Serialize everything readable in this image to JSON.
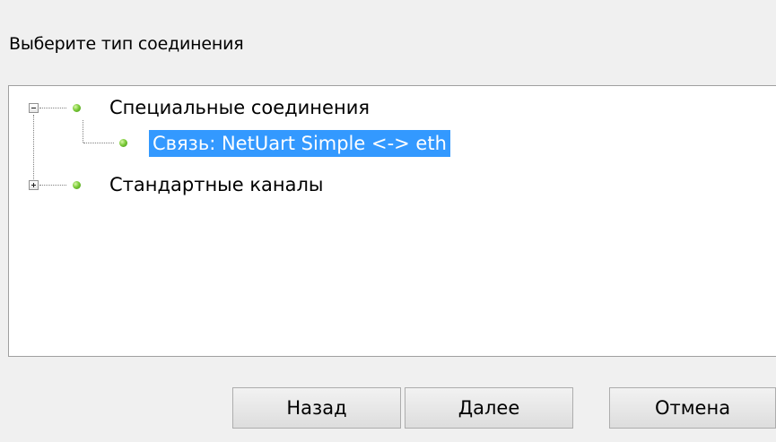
{
  "dialog": {
    "prompt": "Выберите тип соединения"
  },
  "tree": {
    "items": [
      {
        "label": "Специальные соединения",
        "expanded": true,
        "icon": "green-bullet-icon",
        "children": [
          {
            "label": "Связь: NetUart Simple <-> eth",
            "selected": true,
            "icon": "green-bullet-icon"
          }
        ]
      },
      {
        "label": "Стандартные каналы",
        "expanded": false,
        "icon": "green-bullet-icon"
      }
    ]
  },
  "buttons": {
    "back_label": "Назад",
    "next_label": "Далее",
    "cancel_label": "Отмена"
  },
  "colors": {
    "selection": "#3399ff",
    "bullet": "#5fb520"
  }
}
